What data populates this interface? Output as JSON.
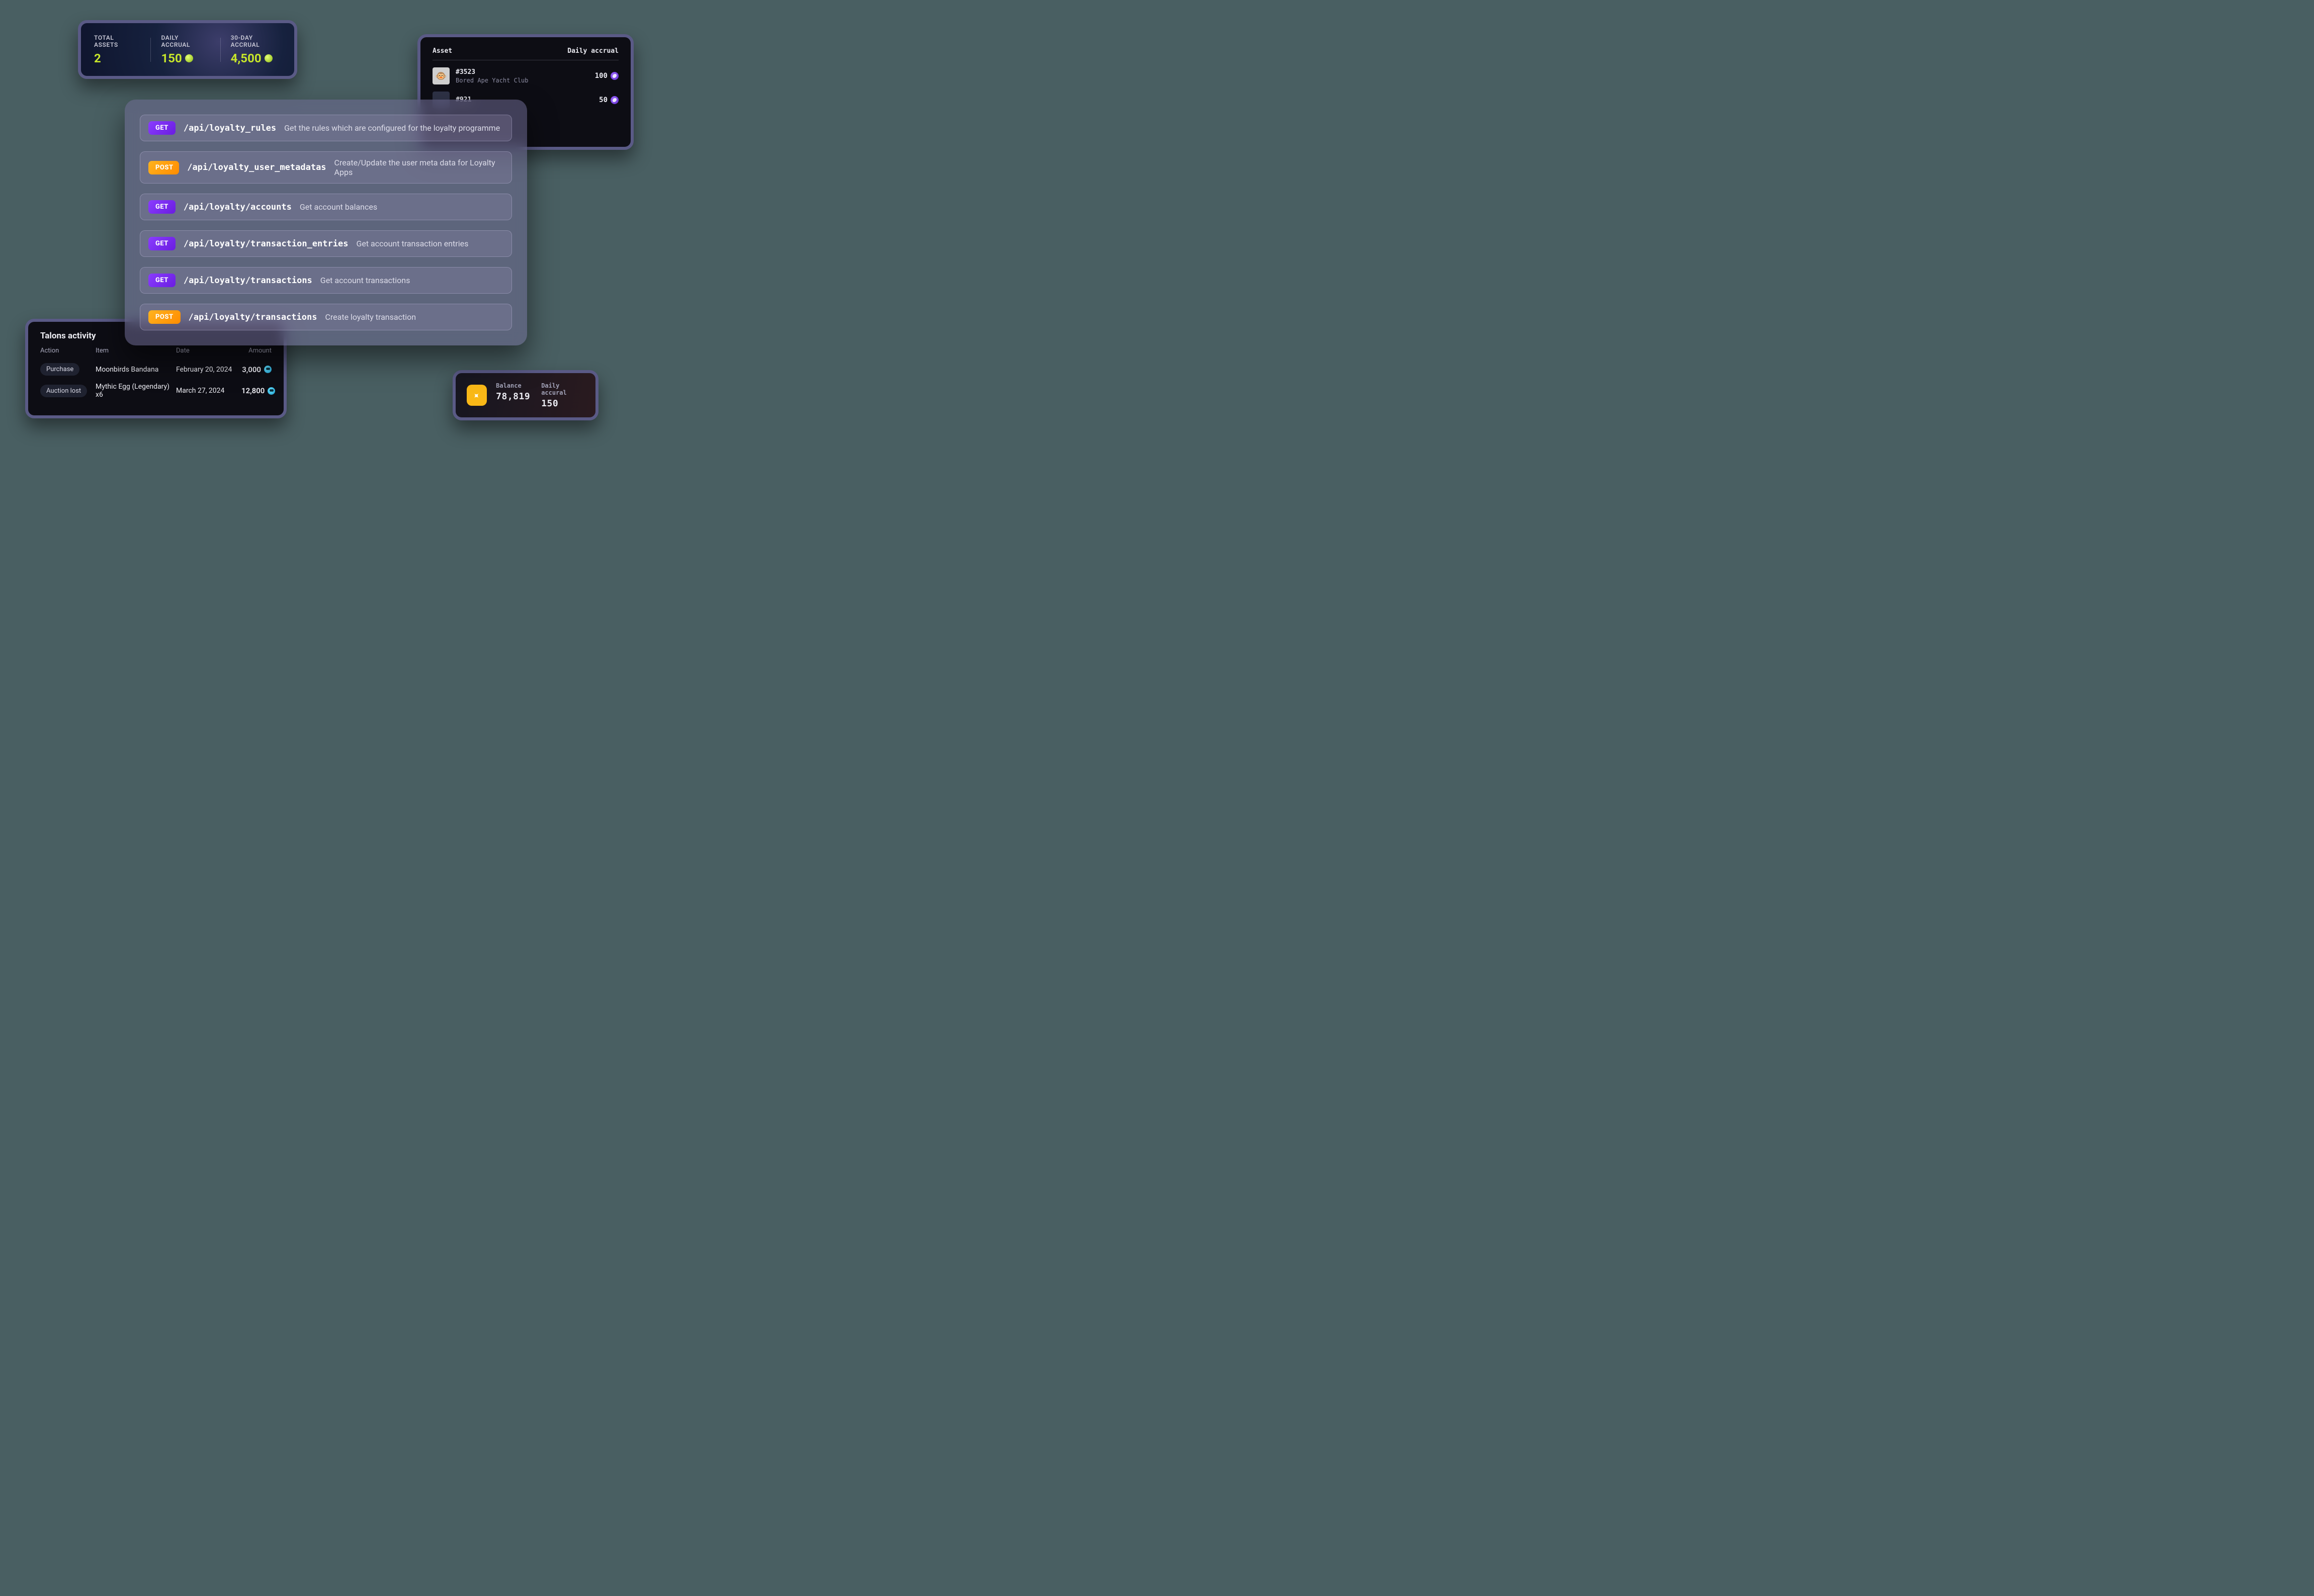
{
  "stats": {
    "items": [
      {
        "label": "TOTAL ASSETS",
        "value": "2",
        "has_token": false
      },
      {
        "label": "DAILY ACCRUAL",
        "value": "150",
        "has_token": true
      },
      {
        "label": "30-DAY ACCRUAL",
        "value": "4,500",
        "has_token": true
      }
    ]
  },
  "assets": {
    "header_left": "Asset",
    "header_right": "Daily accrual",
    "rows": [
      {
        "id": "#3523",
        "collection": "Bored Ape Yacht Club",
        "accrual": "100"
      },
      {
        "id": "#921",
        "collection": "",
        "accrual": "50"
      }
    ]
  },
  "api": {
    "endpoints": [
      {
        "method": "GET",
        "path": "/api/loyalty_rules",
        "desc": "Get the rules which are configured for the loyalty programme"
      },
      {
        "method": "POST",
        "path": "/api/loyalty_user_metadatas",
        "desc": "Create/Update the user meta data for Loyalty Apps"
      },
      {
        "method": "GET",
        "path": "/api/loyalty/accounts",
        "desc": "Get account balances"
      },
      {
        "method": "GET",
        "path": "/api/loyalty/transaction_entries",
        "desc": "Get account transaction entries"
      },
      {
        "method": "GET",
        "path": "/api/loyalty/transactions",
        "desc": "Get account transactions"
      },
      {
        "method": "POST",
        "path": "/api/loyalty/transactions",
        "desc": "Create loyalty transaction"
      }
    ]
  },
  "activity": {
    "title": "Talons activity",
    "columns": {
      "action": "Action",
      "item": "Item",
      "date": "Date",
      "amount": "Amount"
    },
    "rows": [
      {
        "action": "Purchase",
        "item": "Moonbirds Bandana",
        "date": "February 20, 2024",
        "amount": "3,000"
      },
      {
        "action": "Auction lost",
        "item": "Mythic Egg (Legendary) x6",
        "date": "March 27, 2024",
        "amount": "12,800"
      }
    ]
  },
  "balance": {
    "labels": {
      "balance": "Balance",
      "daily_accrual": "Daily accural"
    },
    "balance": "78,819",
    "daily_accrual": "150"
  }
}
